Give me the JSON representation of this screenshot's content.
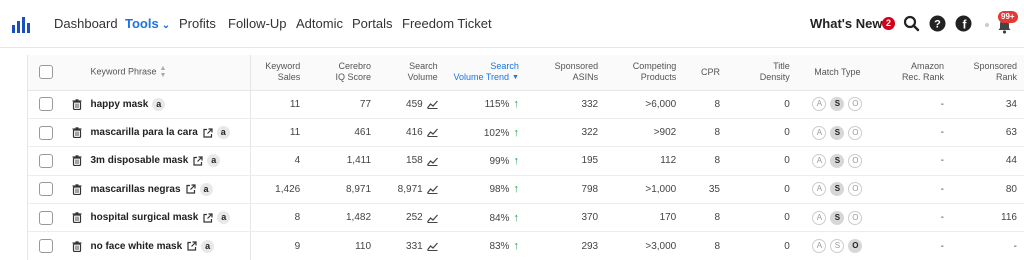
{
  "nav": {
    "items": [
      "Dashboard",
      "Tools",
      "Profits",
      "Follow-Up",
      "Adtomic",
      "Portals",
      "Freedom Ticket"
    ],
    "active": "Tools",
    "whats_new": "What's New?",
    "whats_new_count": "2",
    "notifications": "99+"
  },
  "table": {
    "headers": {
      "keyword": "Keyword Phrase",
      "sales_1": "Keyword",
      "sales_2": "Sales",
      "iq_1": "Cerebro",
      "iq_2": "IQ Score",
      "vol_1": "Search",
      "vol_2": "Volume",
      "trend_1": "Search",
      "trend_2": "Volume Trend",
      "asins_1": "Sponsored",
      "asins_2": "ASINs",
      "comp_1": "Competing",
      "comp_2": "Products",
      "cpr": "CPR",
      "title_1": "Title",
      "title_2": "Density",
      "match": "Match Type",
      "amz_1": "Amazon",
      "amz_2": "Rec. Rank",
      "sp_1": "Sponsored",
      "sp_2": "Rank"
    },
    "match_letters": [
      "A",
      "S",
      "O"
    ],
    "amazon_glyph": "a",
    "rows": [
      {
        "keyword": "happy mask",
        "sales": "11",
        "iq": "77",
        "volume": "459",
        "trend": "115%",
        "asins": "332",
        "competing": ">6,000",
        "cpr": "8",
        "title": "0",
        "match_on": "S",
        "amz_rank": "-",
        "sp_rank": "34"
      },
      {
        "keyword": "mascarilla para la cara",
        "sales": "11",
        "iq": "461",
        "volume": "416",
        "trend": "102%",
        "asins": "322",
        "competing": ">902",
        "cpr": "8",
        "title": "0",
        "match_on": "S",
        "amz_rank": "-",
        "sp_rank": "63"
      },
      {
        "keyword": "3m disposable mask",
        "sales": "4",
        "iq": "1,411",
        "volume": "158",
        "trend": "99%",
        "asins": "195",
        "competing": "112",
        "cpr": "8",
        "title": "0",
        "match_on": "S",
        "amz_rank": "-",
        "sp_rank": "44"
      },
      {
        "keyword": "mascarillas negras",
        "sales": "1,426",
        "iq": "8,971",
        "volume": "8,971",
        "trend": "98%",
        "asins": "798",
        "competing": ">1,000",
        "cpr": "35",
        "title": "0",
        "match_on": "S",
        "amz_rank": "-",
        "sp_rank": "80"
      },
      {
        "keyword": "hospital surgical mask",
        "sales": "8",
        "iq": "1,482",
        "volume": "252",
        "trend": "84%",
        "asins": "370",
        "competing": "170",
        "cpr": "8",
        "title": "0",
        "match_on": "S",
        "amz_rank": "-",
        "sp_rank": "116"
      },
      {
        "keyword": "no face white mask",
        "sales": "9",
        "iq": "110",
        "volume": "331",
        "trend": "83%",
        "asins": "293",
        "competing": ">3,000",
        "cpr": "8",
        "title": "0",
        "match_on": "O",
        "amz_rank": "-",
        "sp_rank": "-"
      }
    ]
  },
  "colors": {
    "accent": "#1a73e8",
    "trend_up": "#22a04b",
    "badge": "#d0021b"
  }
}
